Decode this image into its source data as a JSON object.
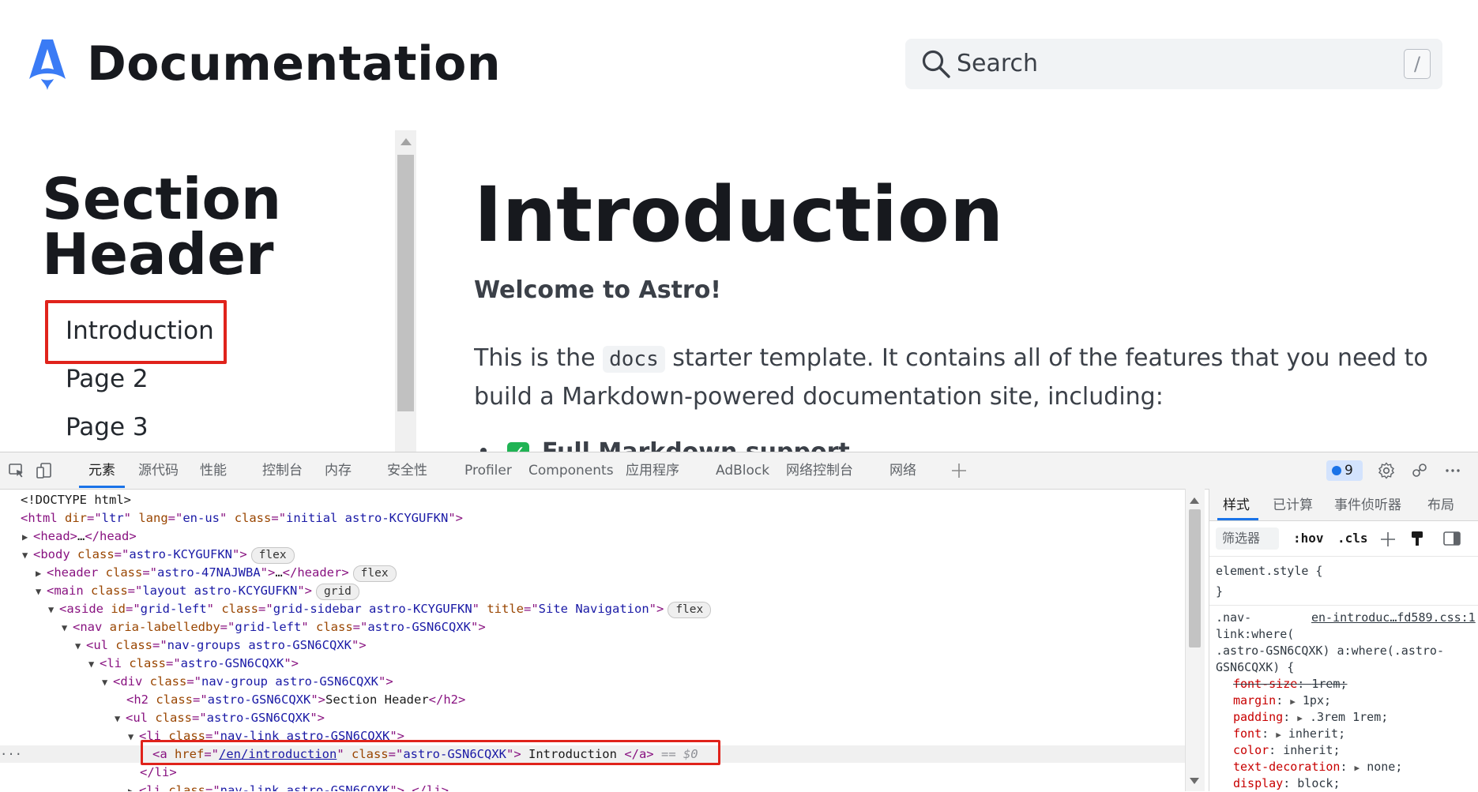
{
  "site": {
    "title": "Documentation",
    "search_placeholder": "Search",
    "search_shortcut": "/"
  },
  "sidebar": {
    "section_header": "Section Header",
    "links": [
      "Introduction",
      "Page 2",
      "Page 3"
    ]
  },
  "main": {
    "title": "Introduction",
    "lead": "Welcome to Astro!",
    "para_before": "This is the ",
    "para_code": "docs",
    "para_after": " starter template. It contains all of the features that you need to build a Markdown-powered documentation site, including:",
    "list_first": "Full Markdown support"
  },
  "devtools": {
    "tabs": [
      "元素",
      "源代码",
      "性能",
      "控制台",
      "内存",
      "安全性",
      "Profiler",
      "Components",
      "应用程序",
      "AdBlock",
      "网络控制台",
      "网络"
    ],
    "issues_count": "9",
    "dom": {
      "doctype": "<!DOCTYPE html>",
      "html_dir": "ltr",
      "html_lang": "en-us",
      "html_class": "initial astro-KCYGUFKN",
      "head_collapsed": "…",
      "body_class": "astro-KCYGUFKN",
      "body_badge": "flex",
      "header_class": "astro-47NAJWBA",
      "header_badge": "flex",
      "main_class": "layout astro-KCYGUFKN",
      "main_badge": "grid",
      "aside_id": "grid-left",
      "aside_class": "grid-sidebar astro-KCYGUFKN",
      "aside_title": "Site Navigation",
      "aside_badge": "flex",
      "nav_labelledby": "grid-left",
      "nav_class": "astro-GSN6CQXK",
      "ul_groups_class": "nav-groups astro-GSN6CQXK",
      "li_class": "astro-GSN6CQXK",
      "div_class": "nav-group astro-GSN6CQXK",
      "h2_class": "astro-GSN6CQXK",
      "h2_text": "Section Header",
      "ul_class": "astro-GSN6CQXK",
      "li_navlink_class": "nav-link astro-GSN6CQXK",
      "a_href": "/en/introduction",
      "a_class": "astro-GSN6CQXK",
      "a_text": " Introduction ",
      "a_marker": "== $0",
      "li_navlink2_class": "nav-link astro-GSN6CQXK"
    },
    "styles": {
      "tabs": [
        "样式",
        "已计算",
        "事件侦听器",
        "布局"
      ],
      "filter_placeholder": "筛选器",
      "hov": ":hov",
      "cls": ".cls",
      "element_style": "element.style {",
      "close_brace": "}",
      "rule_selector_1": ".nav-",
      "rule_selector_2": "link:where(",
      "rule_selector_3": ".astro-GSN6CQXK) a:where(.astro-",
      "rule_selector_4": "GSN6CQXK) {",
      "rule_source": "en-introduc…fd589.css:1",
      "props": [
        {
          "name": "font-size",
          "value": "1rem",
          "struck": true
        },
        {
          "name": "margin",
          "value": "1px"
        },
        {
          "name": "padding",
          "value": ".3rem 1rem"
        },
        {
          "name": "font",
          "value": "inherit"
        },
        {
          "name": "color",
          "value": "inherit"
        },
        {
          "name": "text-decoration",
          "value": "none"
        },
        {
          "name": "display",
          "value": "block"
        }
      ]
    }
  },
  "colors": {
    "highlight_box": "#e0231b",
    "logo_blue": "#3a7bf5",
    "devtools_accent": "#1a73e8"
  }
}
